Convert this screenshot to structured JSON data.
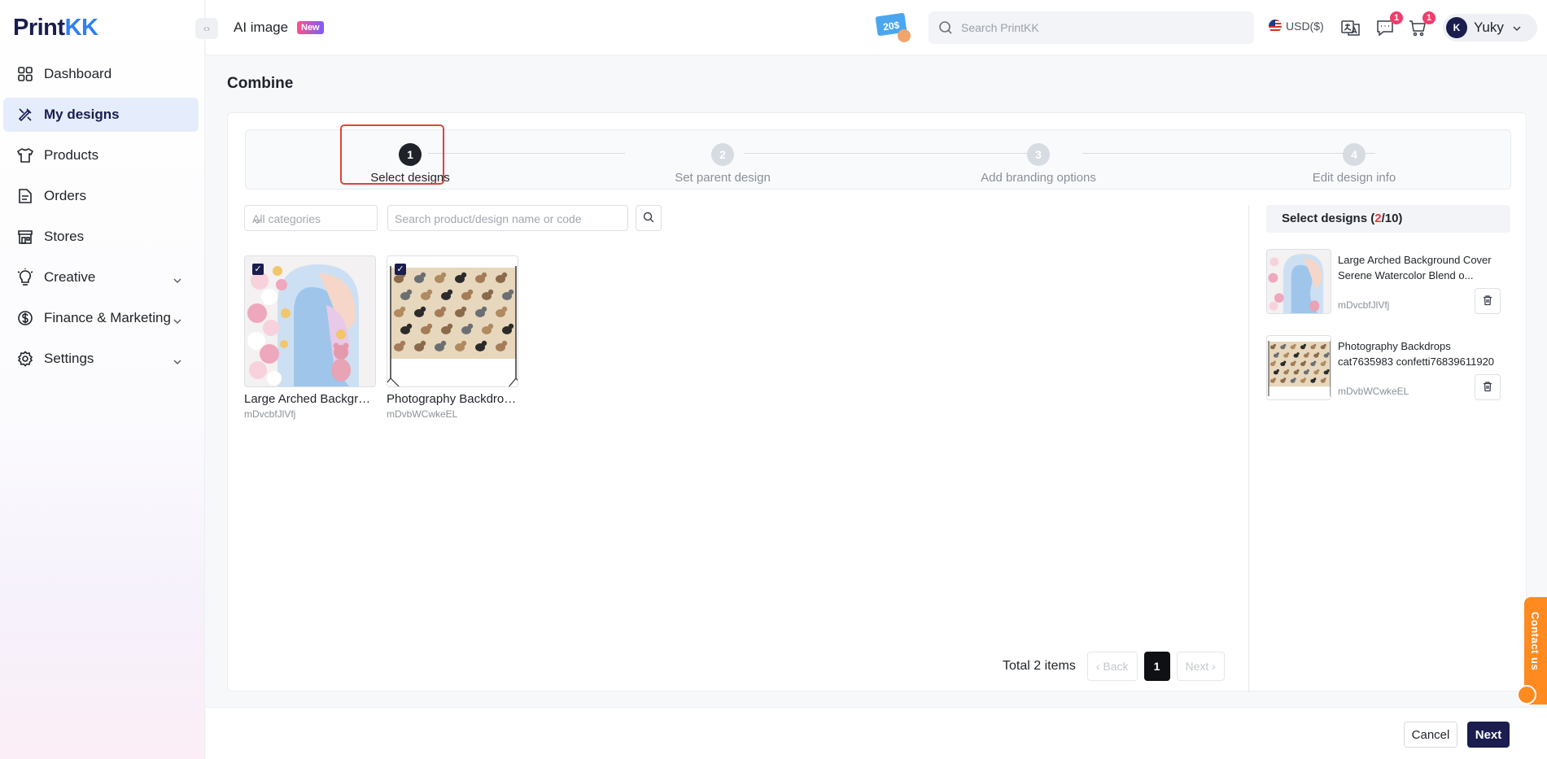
{
  "app": {
    "logo_main": "Print",
    "logo_accent": "KK"
  },
  "sidebar": {
    "items": [
      {
        "label": "Dashboard",
        "icon": "grid-icon"
      },
      {
        "label": "My designs",
        "icon": "design-tools-icon",
        "active": true
      },
      {
        "label": "Products",
        "icon": "tshirt-icon"
      },
      {
        "label": "Orders",
        "icon": "document-icon"
      },
      {
        "label": "Stores",
        "icon": "store-icon"
      },
      {
        "label": "Creative",
        "icon": "lightbulb-icon",
        "expandable": true
      },
      {
        "label": "Finance & Marketing",
        "icon": "dollar-icon",
        "expandable": true
      },
      {
        "label": "Settings",
        "icon": "gear-icon",
        "expandable": true
      }
    ]
  },
  "header": {
    "ai_label": "AI image",
    "new_badge": "New",
    "promo_label": "20$",
    "search_placeholder": "Search PrintKK",
    "currency": "USD($)",
    "messages_count": "1",
    "cart_count": "1",
    "avatar_initials": "K",
    "user_name": "Yuky"
  },
  "page": {
    "title": "Combine"
  },
  "steps": [
    {
      "num": "1",
      "label": "Select designs",
      "active": true
    },
    {
      "num": "2",
      "label": "Set parent design"
    },
    {
      "num": "3",
      "label": "Add branding options"
    },
    {
      "num": "4",
      "label": "Edit design info"
    }
  ],
  "filters": {
    "category_placeholder": "All categories",
    "search_placeholder": "Search product/design name or code"
  },
  "designs": [
    {
      "name": "Large Arched Background Cover Serene Watercolor Blend o...",
      "code": "mDvcbfJlVfj",
      "checked": true
    },
    {
      "name": "Photography Backdrops cat7635983 confetti76839611920",
      "code": "mDvbWCwkeEL",
      "checked": true
    }
  ],
  "pagination": {
    "total": "Total 2 items",
    "back": "Back",
    "page": "1",
    "next": "Next"
  },
  "selected_panel": {
    "title_prefix": "Select designs (",
    "count": "2",
    "title_suffix": "/10)",
    "items": [
      {
        "name": "Large Arched Background Cover Serene Watercolor Blend o...",
        "code": "mDvcbfJlVfj"
      },
      {
        "name": "Photography Backdrops cat7635983 confetti76839611920",
        "code": "mDvbWCwkeEL"
      }
    ]
  },
  "footer": {
    "cancel": "Cancel",
    "next": "Next"
  },
  "contact": {
    "label": "Contact us"
  },
  "colors": {
    "brand": "#1a1d4e",
    "accent": "#2f7ff4",
    "highlight": "#e0433a",
    "contact": "#ff8a1f"
  }
}
